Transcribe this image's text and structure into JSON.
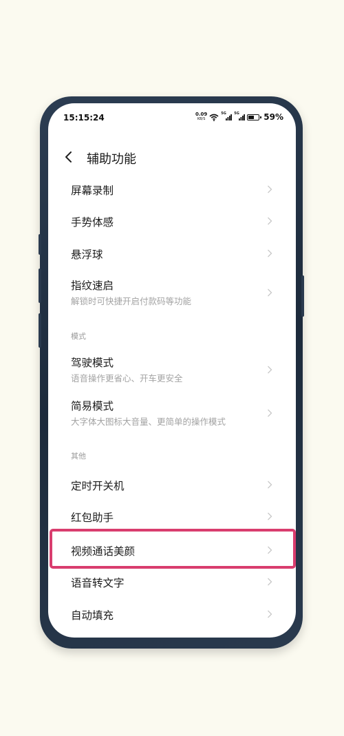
{
  "status_bar": {
    "time": "15:15:24",
    "net_speed": "0.09",
    "net_speed_unit": "KB/S",
    "signal1_label": "5G",
    "signal2_label": "5G",
    "battery_level": 0.59,
    "battery_text": "59%"
  },
  "header": {
    "title": "辅助功能",
    "back_icon": "chevron-left-icon"
  },
  "items": [
    {
      "title": "屏幕录制"
    },
    {
      "title": "手势体感"
    },
    {
      "title": "悬浮球"
    },
    {
      "title": "指纹速启",
      "subtitle": "解锁时可快捷开启付款码等功能"
    }
  ],
  "section_mode": {
    "label": "模式",
    "items": [
      {
        "title": "驾驶模式",
        "subtitle": "语音操作更省心、开车更安全"
      },
      {
        "title": "简易模式",
        "subtitle": "大字体大图标大音量、更简单的操作模式"
      }
    ]
  },
  "section_other": {
    "label": "其他",
    "items": [
      {
        "title": "定时开关机"
      },
      {
        "title": "红包助手"
      },
      {
        "title": "视频通话美颜"
      },
      {
        "title": "语音转文字"
      },
      {
        "title": "自动填充"
      }
    ]
  },
  "highlight_color": "#d93d6e"
}
